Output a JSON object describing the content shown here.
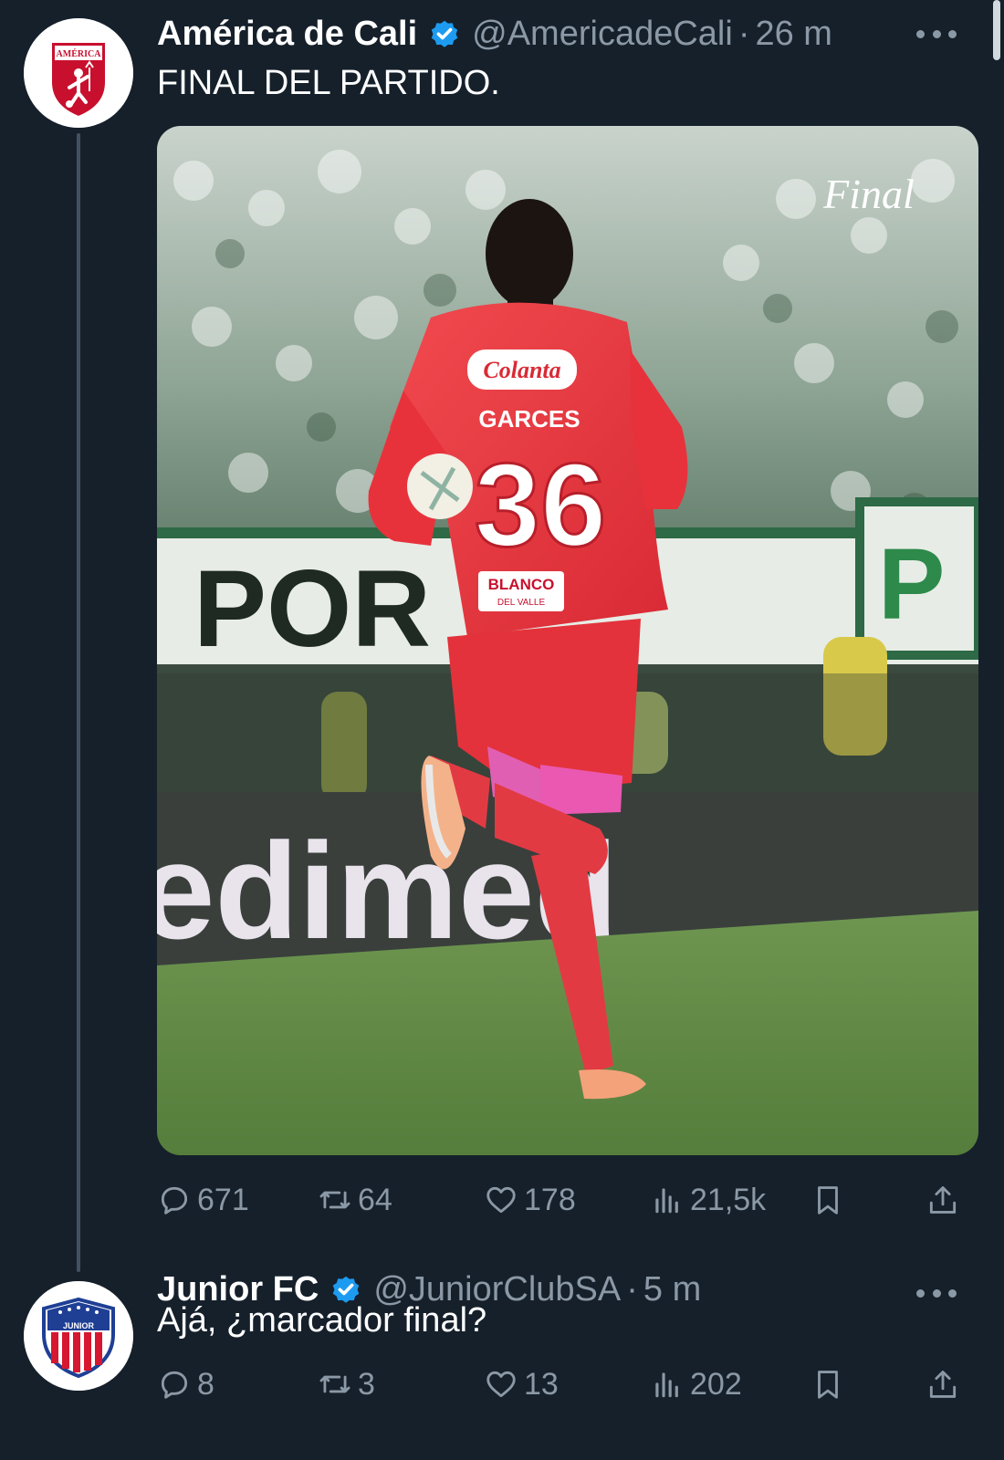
{
  "tweets": [
    {
      "author": "América de Cali",
      "handle": "@AmericadeCali",
      "time": "26 m",
      "text": "FINAL DEL PARTIDO.",
      "avatar_text": "AMÉRICA",
      "media": {
        "overlay_text": "Final",
        "jersey_sponsor": "Colanta",
        "jersey_name": "GARCES",
        "jersey_number": "36",
        "shorts_sponsor_line1": "BLANCO",
        "shorts_sponsor_line2": "DEL VALLE",
        "banner_text": "POR",
        "ad_board_text": "edimed",
        "banner_right_text": "P"
      },
      "stats": {
        "replies": "671",
        "reposts": "64",
        "likes": "178",
        "views": "21,5k"
      }
    },
    {
      "author": "Junior FC",
      "handle": "@JuniorClubSA",
      "time": "5 m",
      "text": "Ajá, ¿marcador final?",
      "avatar_text": "JUNIOR",
      "stats": {
        "replies": "8",
        "reposts": "3",
        "likes": "13",
        "views": "202"
      }
    }
  ],
  "separator": "·",
  "colors": {
    "background": "#15202b",
    "secondary_text": "#8b98a5",
    "verified": "#1d9bf0",
    "america_red": "#c8102e",
    "junior_red": "#d6172f",
    "junior_blue": "#1f3f95"
  },
  "icons": [
    "verified-icon",
    "more-icon",
    "reply-icon",
    "repost-icon",
    "like-icon",
    "views-icon",
    "bookmark-icon",
    "share-icon"
  ]
}
